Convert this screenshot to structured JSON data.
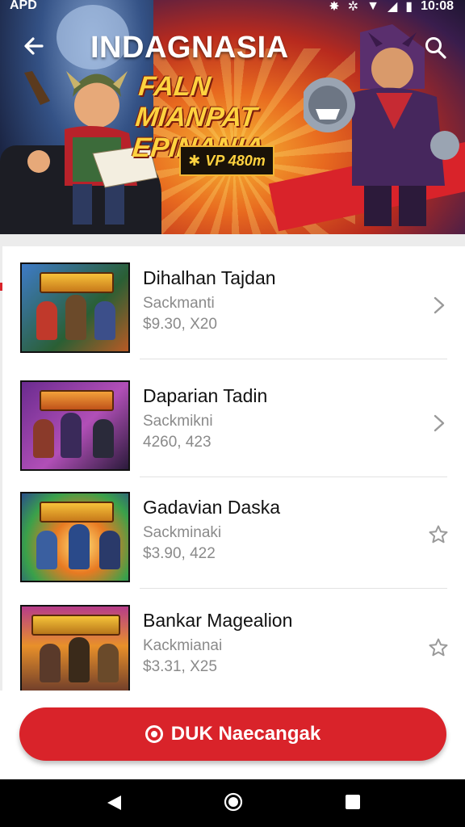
{
  "status_bar": {
    "carrier": "APD",
    "time": "10:08"
  },
  "header": {
    "title": "INDAGNASIA",
    "back_icon": "arrow-left-icon",
    "search_icon": "search-icon"
  },
  "promo": {
    "title": "FALN MIANPAT EPINANIA",
    "badge": "VP 480m"
  },
  "items": [
    {
      "title": "Dihalhan Tajdan",
      "subtitle": "Sackmanti",
      "price": "$9.30, X20",
      "action_icon": "chevron-right-icon"
    },
    {
      "title": "Daparian Tadin",
      "subtitle": "Sackmikni",
      "price": "4260, 423",
      "action_icon": "chevron-right-icon"
    },
    {
      "title": "Gadavian Daska",
      "subtitle": "Sackminaki",
      "price": "$3.90, 422",
      "action_icon": "star-outline-icon"
    },
    {
      "title": "Bankar Magealion",
      "subtitle": "Kackmianai",
      "price": "$3.31, X25",
      "action_icon": "star-outline-icon"
    }
  ],
  "cta": {
    "label": "DUK Naecangak",
    "icon": "radio-dot-icon"
  },
  "nav": {
    "back_icon": "nav-back-icon",
    "home_icon": "nav-home-icon",
    "recent_icon": "nav-recent-icon"
  },
  "colors": {
    "accent": "#d9232a",
    "promo_yellow": "#ffd23f"
  }
}
